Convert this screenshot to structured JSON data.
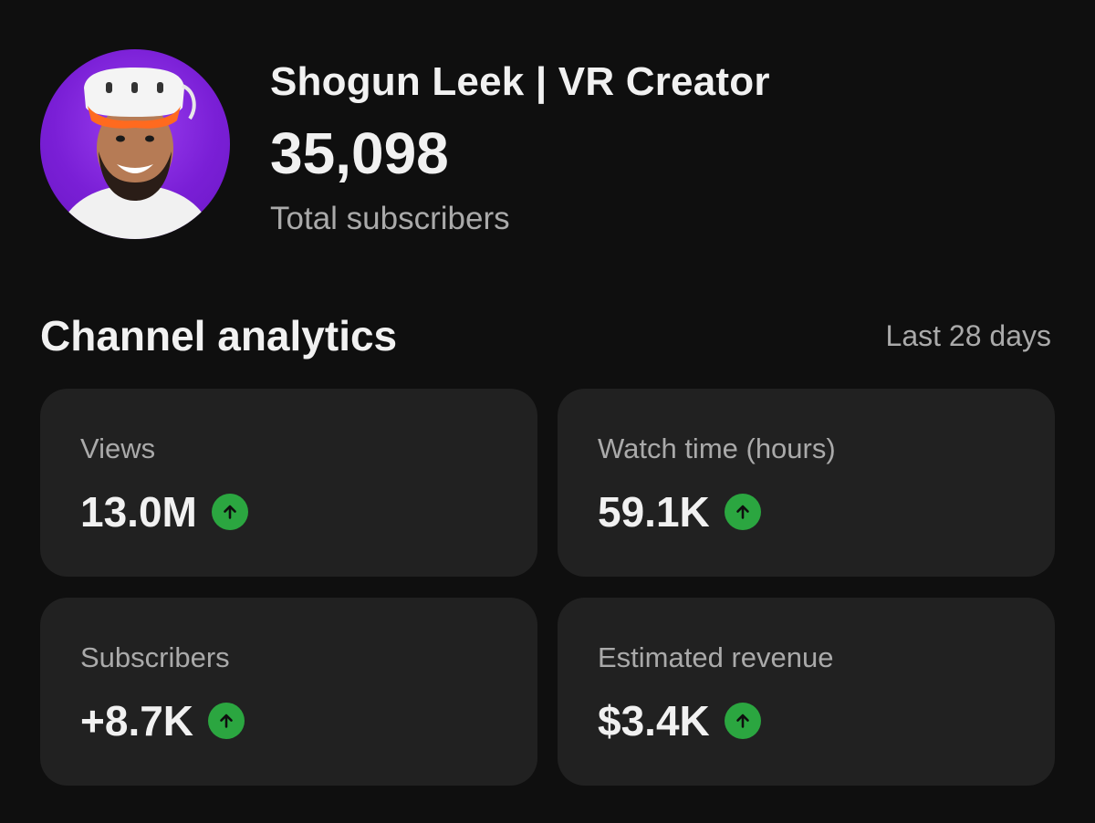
{
  "channel": {
    "name": "Shogun Leek | VR Creator",
    "subscriber_count": "35,098",
    "subscriber_label": "Total subscribers"
  },
  "analytics": {
    "title": "Channel analytics",
    "period": "Last 28 days",
    "cards": [
      {
        "label": "Views",
        "value": "13.0M",
        "trend": "up"
      },
      {
        "label": "Watch time (hours)",
        "value": "59.1K",
        "trend": "up"
      },
      {
        "label": "Subscribers",
        "value": "+8.7K",
        "trend": "up"
      },
      {
        "label": "Estimated revenue",
        "value": "$3.4K",
        "trend": "up"
      }
    ]
  },
  "icons": {
    "trend": "arrow-up-icon",
    "avatar": "avatar"
  },
  "colors": {
    "background": "#0f0f0f",
    "card": "#212121",
    "trend_up": "#2ba640",
    "avatar_bg": "#7a1fd6",
    "secondary_text": "#aaaaaa"
  }
}
